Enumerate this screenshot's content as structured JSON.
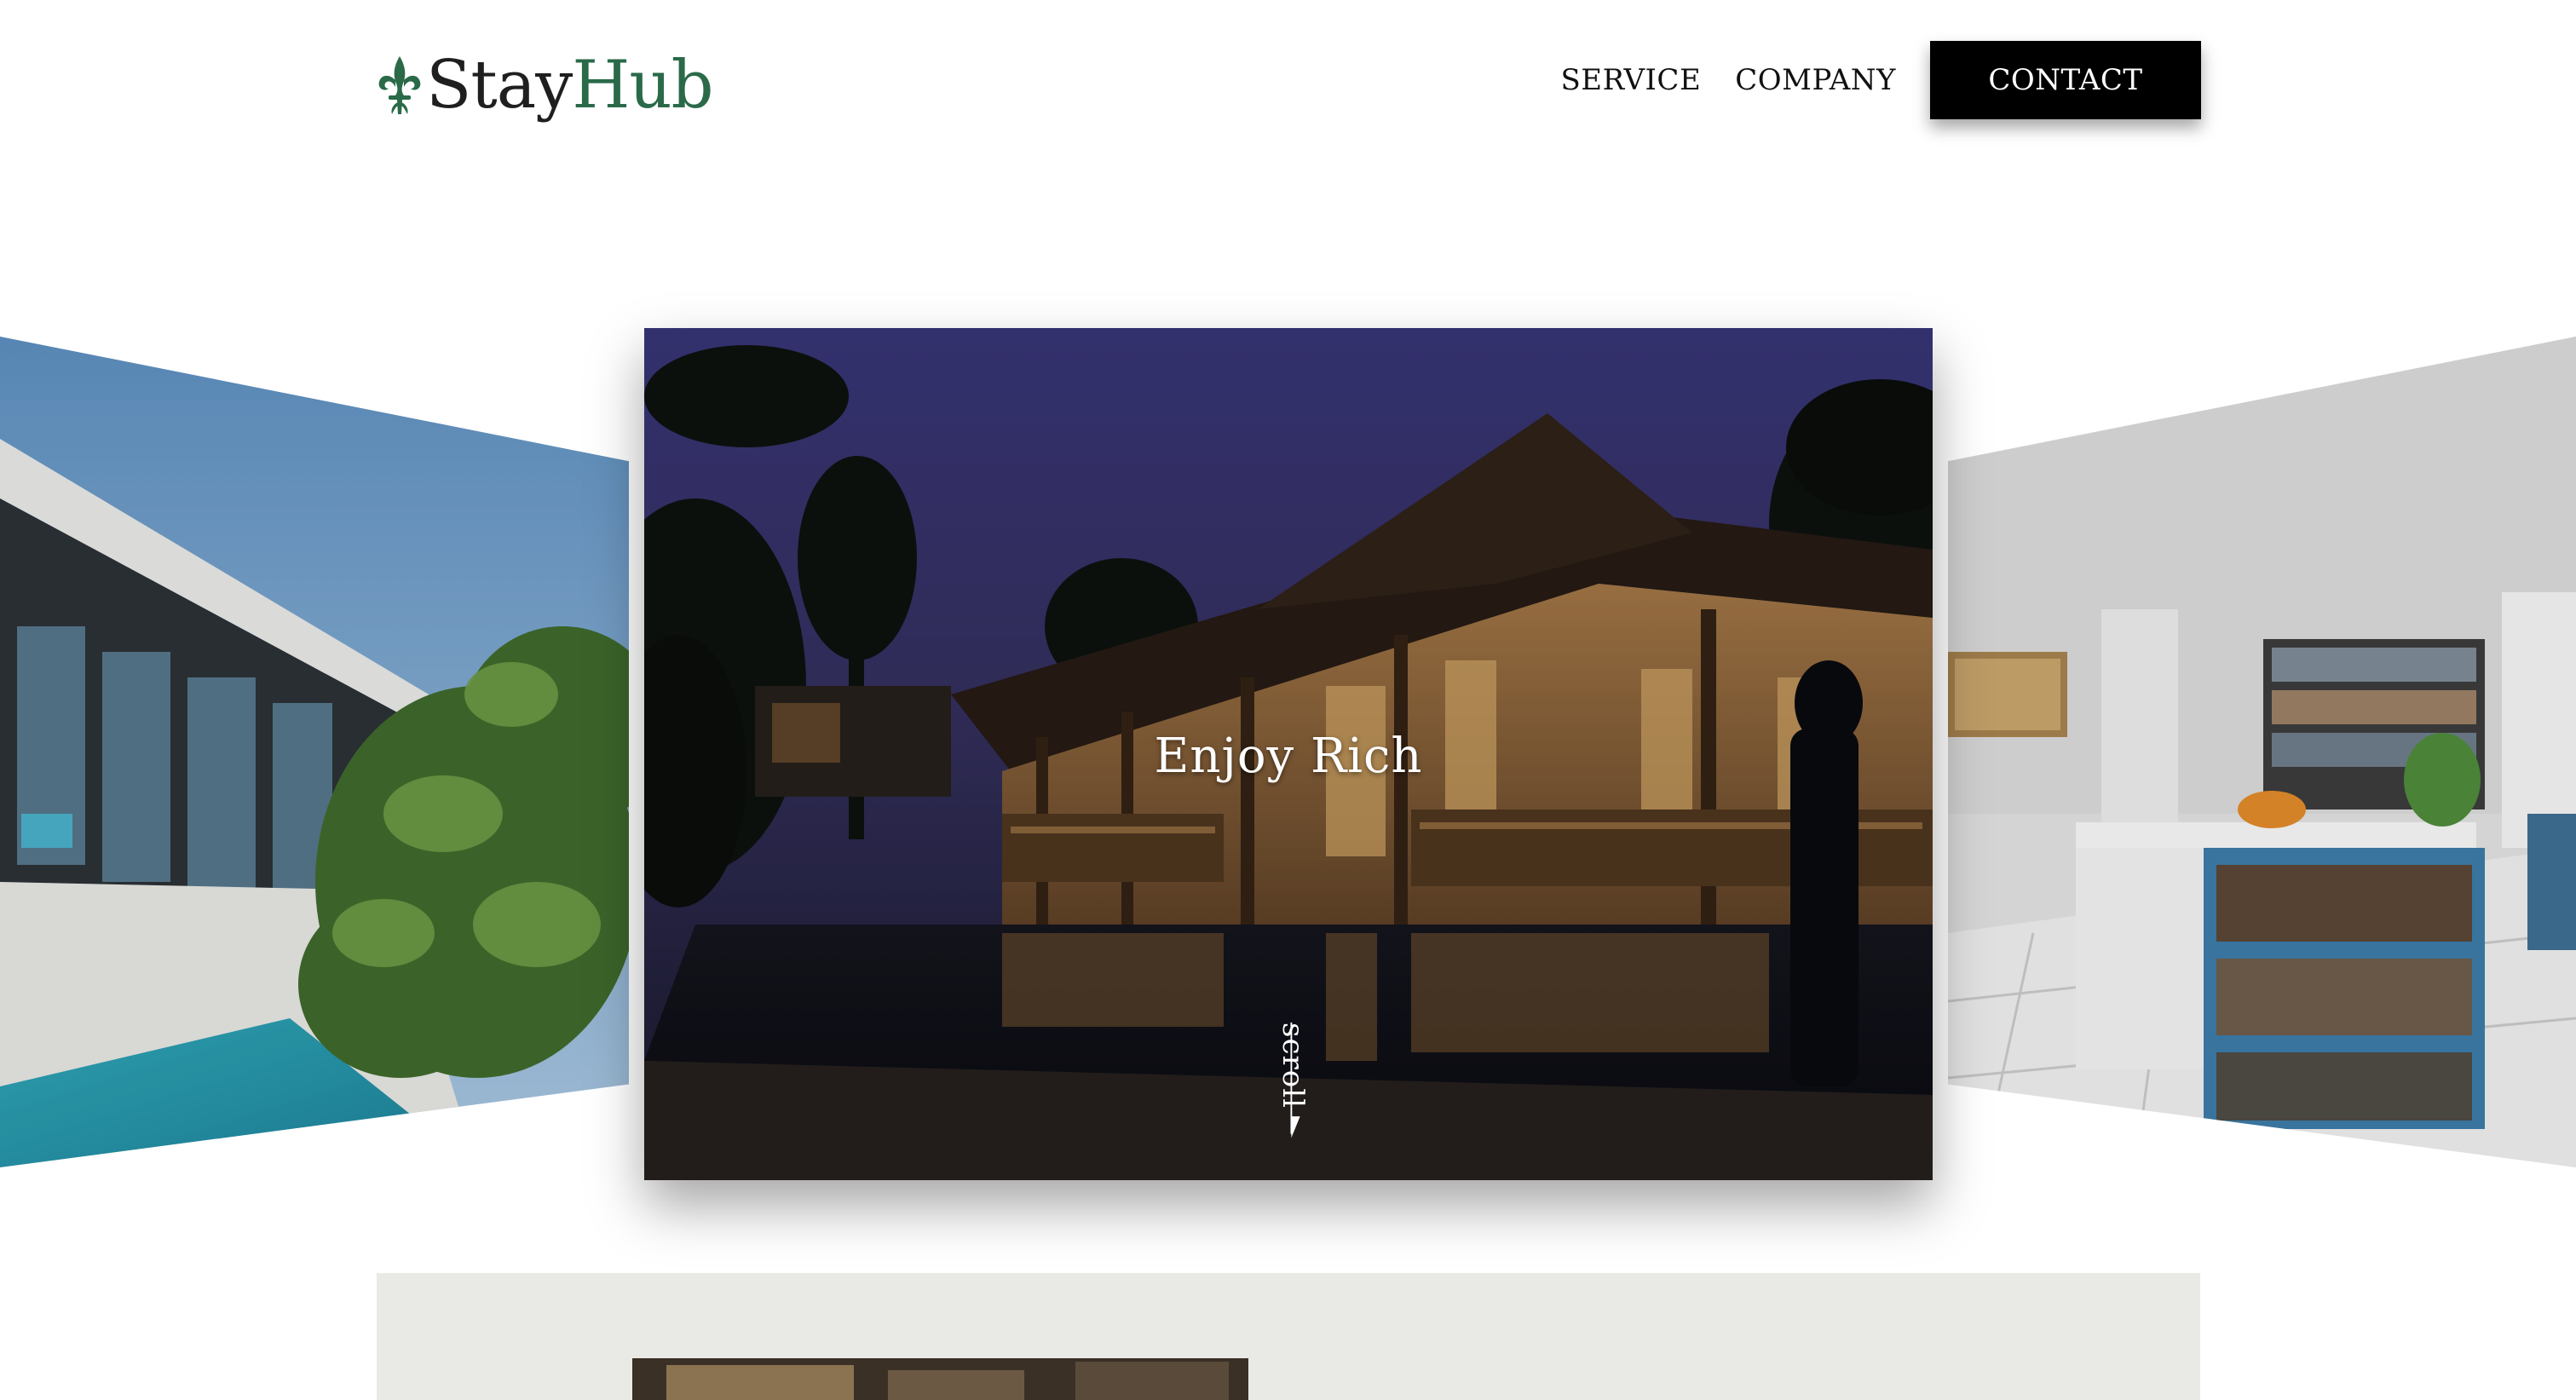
{
  "brand": {
    "name_part1": "Stay",
    "name_part2": "Hub",
    "logo_icon": "fleur-de-lis-icon",
    "accent": "#2a6a49"
  },
  "nav": {
    "items": [
      {
        "label": "SERVICE"
      },
      {
        "label": "COMPANY"
      }
    ],
    "contact_label": "CONTACT"
  },
  "hero": {
    "title": "Enjoy Rich",
    "scroll_label": "scroll",
    "scroll_icon": "arrow-down-icon"
  },
  "slides": [
    {
      "name": "left-slide",
      "scene": "modern white villa with pool and shrub"
    },
    {
      "name": "center-slide",
      "scene": "wooden villa at dusk with pool"
    },
    {
      "name": "right-slide",
      "scene": "bright kitchen with blue bookshelf island"
    }
  ],
  "colors": {
    "contact_bg": "#000000",
    "section_bg": "#e9e9e5"
  }
}
